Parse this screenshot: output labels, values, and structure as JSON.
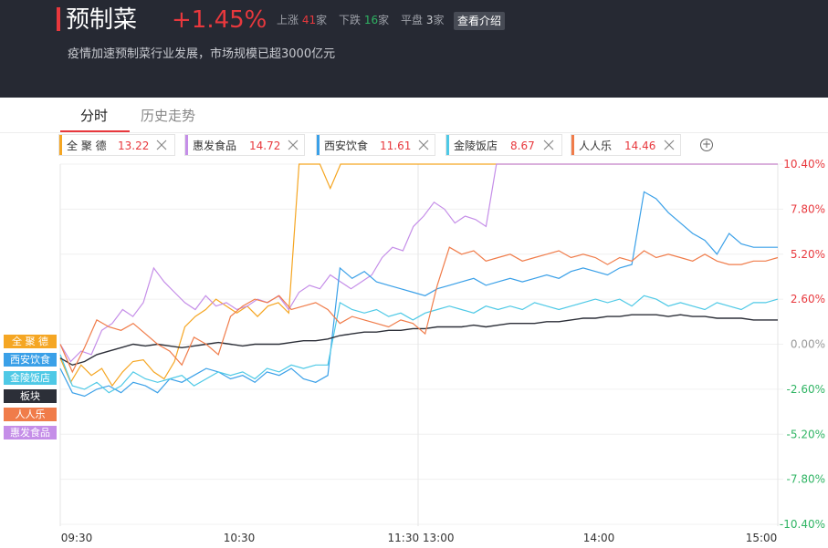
{
  "header": {
    "title": "预制菜",
    "change_pct": "+1.45%",
    "up_label": "上涨",
    "up_count": "41",
    "up_unit": "家",
    "down_label": "下跌",
    "down_count": "16",
    "down_unit": "家",
    "flat_label": "平盘",
    "flat_count": "3",
    "flat_unit": "家",
    "intro_button": "查看介绍",
    "subtitle": "疫情加速预制菜行业发展，市场规模已超3000亿元"
  },
  "tabs": [
    {
      "label": "分时",
      "active": true
    },
    {
      "label": "历史走势",
      "active": false
    }
  ],
  "chips": [
    {
      "name": "全 聚 德",
      "price": "13.22",
      "color": "#f5a623"
    },
    {
      "name": "惠发食品",
      "price": "14.72",
      "color": "#c58ee8"
    },
    {
      "name": "西安饮食",
      "price": "11.61",
      "color": "#3aa0e8"
    },
    {
      "name": "金陵饭店",
      "price": "8.67",
      "color": "#4ec9e6"
    },
    {
      "name": "人人乐",
      "price": "14.46",
      "color": "#f07c4a"
    }
  ],
  "add_icon": "plus-circle-icon",
  "legend_tags": [
    {
      "label": "全 聚 德",
      "color": "#f5a623"
    },
    {
      "label": "西安饮食",
      "color": "#3aa0e8"
    },
    {
      "label": "金陵饭店",
      "color": "#4ec9e6"
    },
    {
      "label": "板块",
      "color": "#2c2f38"
    },
    {
      "label": "人人乐",
      "color": "#f07c4a"
    },
    {
      "label": "惠发食品",
      "color": "#c58ee8"
    }
  ],
  "chart_data": {
    "type": "line",
    "y_unit": "%",
    "ylim": [
      -10.4,
      10.4
    ],
    "y_ticks": [
      "10.40%",
      "7.80%",
      "5.20%",
      "2.60%",
      "0.00%",
      "-2.60%",
      "-5.20%",
      "-7.80%",
      "-10.40%"
    ],
    "x_ticks": [
      "09:30",
      "10:30",
      "11:30 13:00",
      "14:00",
      "15:00"
    ],
    "colors": {
      "up": "#e8383d",
      "zero": "#999999",
      "down": "#2fb463"
    },
    "series": [
      {
        "name": "全 聚 德",
        "color": "#f5a623",
        "values": [
          -0.8,
          -2.2,
          -1.2,
          -1.8,
          -1.4,
          -2.4,
          -1.6,
          -1.0,
          -0.9,
          -1.6,
          -2.0,
          -1.0,
          1.0,
          1.6,
          2.0,
          2.6,
          2.2,
          1.8,
          2.2,
          1.6,
          2.2,
          2.4,
          1.8,
          10.4,
          10.4,
          10.4,
          9.0,
          10.4,
          10.4,
          10.4,
          10.4,
          10.4,
          10.4,
          10.4,
          10.4,
          10.4,
          10.4,
          10.4,
          10.4,
          10.4,
          10.4,
          10.4,
          10.4,
          10.4,
          10.4,
          10.4,
          10.4,
          10.4,
          10.4
        ]
      },
      {
        "name": "惠发食品",
        "color": "#c58ee8",
        "values": [
          0.0,
          -1.0,
          -0.4,
          -0.6,
          0.8,
          1.2,
          2.0,
          1.6,
          2.4,
          4.4,
          3.6,
          3.0,
          2.4,
          2.0,
          2.8,
          2.2,
          2.4,
          2.0,
          2.2,
          2.6,
          2.4,
          2.8,
          2.0,
          3.0,
          3.4,
          3.2,
          4.0,
          3.6,
          3.2,
          3.6,
          4.0,
          5.0,
          5.6,
          5.4,
          6.8,
          7.4,
          8.2,
          7.8,
          7.0,
          7.4,
          7.2,
          6.8,
          10.4,
          10.4,
          10.4,
          10.4,
          10.4,
          10.4,
          10.4
        ]
      },
      {
        "name": "西安饮食",
        "color": "#3aa0e8",
        "values": [
          -1.4,
          -2.8,
          -3.0,
          -2.6,
          -2.4,
          -2.8,
          -2.2,
          -2.4,
          -2.8,
          -2.0,
          -2.2,
          -1.8,
          -1.4,
          -1.6,
          -2.0,
          -1.8,
          -2.2,
          -1.6,
          -1.8,
          -1.4,
          -2.0,
          -2.2,
          -1.8,
          4.4,
          3.8,
          4.2,
          3.6,
          3.4,
          3.2,
          3.0,
          2.8,
          3.2,
          3.4,
          3.6,
          3.8,
          3.4,
          3.6,
          3.8,
          3.6,
          3.8,
          4.0,
          3.8,
          4.2,
          4.4,
          4.2,
          4.0,
          4.4,
          4.6,
          8.8,
          8.4,
          7.6,
          7.0,
          6.4,
          6.0,
          5.2,
          6.4,
          5.8,
          5.6,
          5.6,
          5.6
        ]
      },
      {
        "name": "金陵饭店",
        "color": "#4ec9e6",
        "values": [
          -0.6,
          -2.4,
          -2.6,
          -2.2,
          -2.8,
          -2.4,
          -1.6,
          -2.0,
          -2.2,
          -2.0,
          -1.8,
          -2.4,
          -2.0,
          -1.6,
          -1.8,
          -1.6,
          -2.0,
          -1.4,
          -1.6,
          -1.2,
          -1.4,
          -1.2,
          -1.2,
          2.4,
          2.0,
          1.8,
          2.0,
          1.6,
          1.8,
          1.4,
          1.8,
          2.0,
          2.2,
          2.0,
          1.8,
          2.2,
          2.0,
          2.2,
          2.0,
          2.4,
          2.2,
          2.0,
          2.2,
          2.4,
          2.6,
          2.4,
          2.6,
          2.2,
          2.8,
          2.6,
          2.2,
          2.4,
          2.2,
          2.0,
          2.4,
          2.2,
          2.0,
          2.4,
          2.4,
          2.6
        ]
      },
      {
        "name": "板块",
        "color": "#2c2f38",
        "values": [
          -0.8,
          -1.2,
          -1.0,
          -0.6,
          -0.4,
          -0.2,
          0.0,
          -0.1,
          0.0,
          -0.1,
          -0.2,
          -0.1,
          0.0,
          0.1,
          0.0,
          -0.1,
          0.0,
          0.0,
          0.0,
          0.1,
          0.2,
          0.2,
          0.3,
          0.5,
          0.6,
          0.7,
          0.7,
          0.8,
          0.8,
          0.9,
          0.9,
          1.0,
          1.0,
          1.0,
          1.1,
          1.0,
          1.1,
          1.2,
          1.2,
          1.2,
          1.3,
          1.3,
          1.4,
          1.5,
          1.5,
          1.6,
          1.6,
          1.7,
          1.7,
          1.7,
          1.6,
          1.7,
          1.6,
          1.6,
          1.5,
          1.5,
          1.5,
          1.4,
          1.4,
          1.4
        ]
      },
      {
        "name": "人人乐",
        "color": "#f07c4a",
        "values": [
          0.0,
          -1.6,
          -0.2,
          1.4,
          1.0,
          0.8,
          1.2,
          0.6,
          0.0,
          -0.4,
          -1.2,
          0.4,
          0.0,
          -0.6,
          1.6,
          2.2,
          2.6,
          2.4,
          2.8,
          2.0,
          2.2,
          2.4,
          2.0,
          1.2,
          1.6,
          1.4,
          1.2,
          1.0,
          1.4,
          1.2,
          0.6,
          3.4,
          5.6,
          5.2,
          5.4,
          4.8,
          5.0,
          5.2,
          4.8,
          5.0,
          5.2,
          5.4,
          5.0,
          5.2,
          5.0,
          4.6,
          5.0,
          4.8,
          5.4,
          5.0,
          5.2,
          5.0,
          4.8,
          5.2,
          4.8,
          4.6,
          4.6,
          4.8,
          4.8,
          5.0
        ]
      }
    ]
  }
}
